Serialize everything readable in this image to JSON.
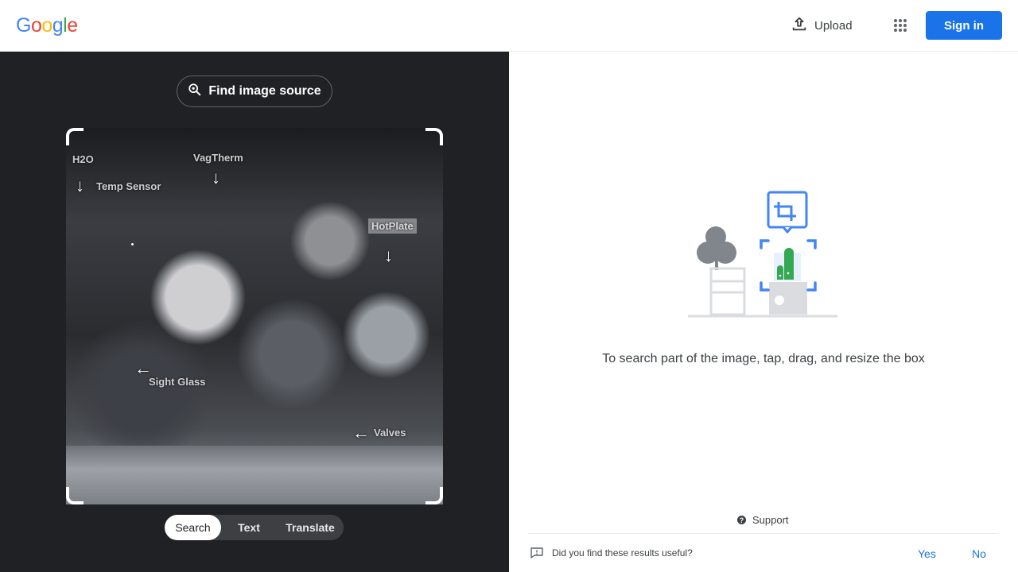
{
  "header": {
    "logo_letters": [
      {
        "char": "G",
        "color": "#4285f4"
      },
      {
        "char": "o",
        "color": "#ea4335"
      },
      {
        "char": "o",
        "color": "#fbbc05"
      },
      {
        "char": "g",
        "color": "#4285f4"
      },
      {
        "char": "l",
        "color": "#34a853"
      },
      {
        "char": "e",
        "color": "#ea4335"
      }
    ],
    "upload_label": "Upload",
    "upload_icon": "upload-icon",
    "apps_icon": "apps-grid-icon",
    "signin_label": "Sign in",
    "accent": "#1a73e8"
  },
  "left_panel": {
    "find_source_label": "Find image source",
    "find_source_icon": "lens-search-icon",
    "photo_labels": {
      "top_left": "H2O",
      "temp_sensor": "Temp Sensor",
      "vag_therm": "VagTherm",
      "hot_plate": "HotPlate",
      "sight_glass": "Sight Glass",
      "valves": "Valves"
    },
    "modes": [
      "Search",
      "Text",
      "Translate"
    ],
    "active_mode": "Search",
    "background": "#202124"
  },
  "right_panel": {
    "hint": "To search part of the image, tap, drag, and resize the box",
    "support_label": "Support",
    "feedback_question": "Did you find these results useful?",
    "feedback_yes": "Yes",
    "feedback_no": "No"
  }
}
